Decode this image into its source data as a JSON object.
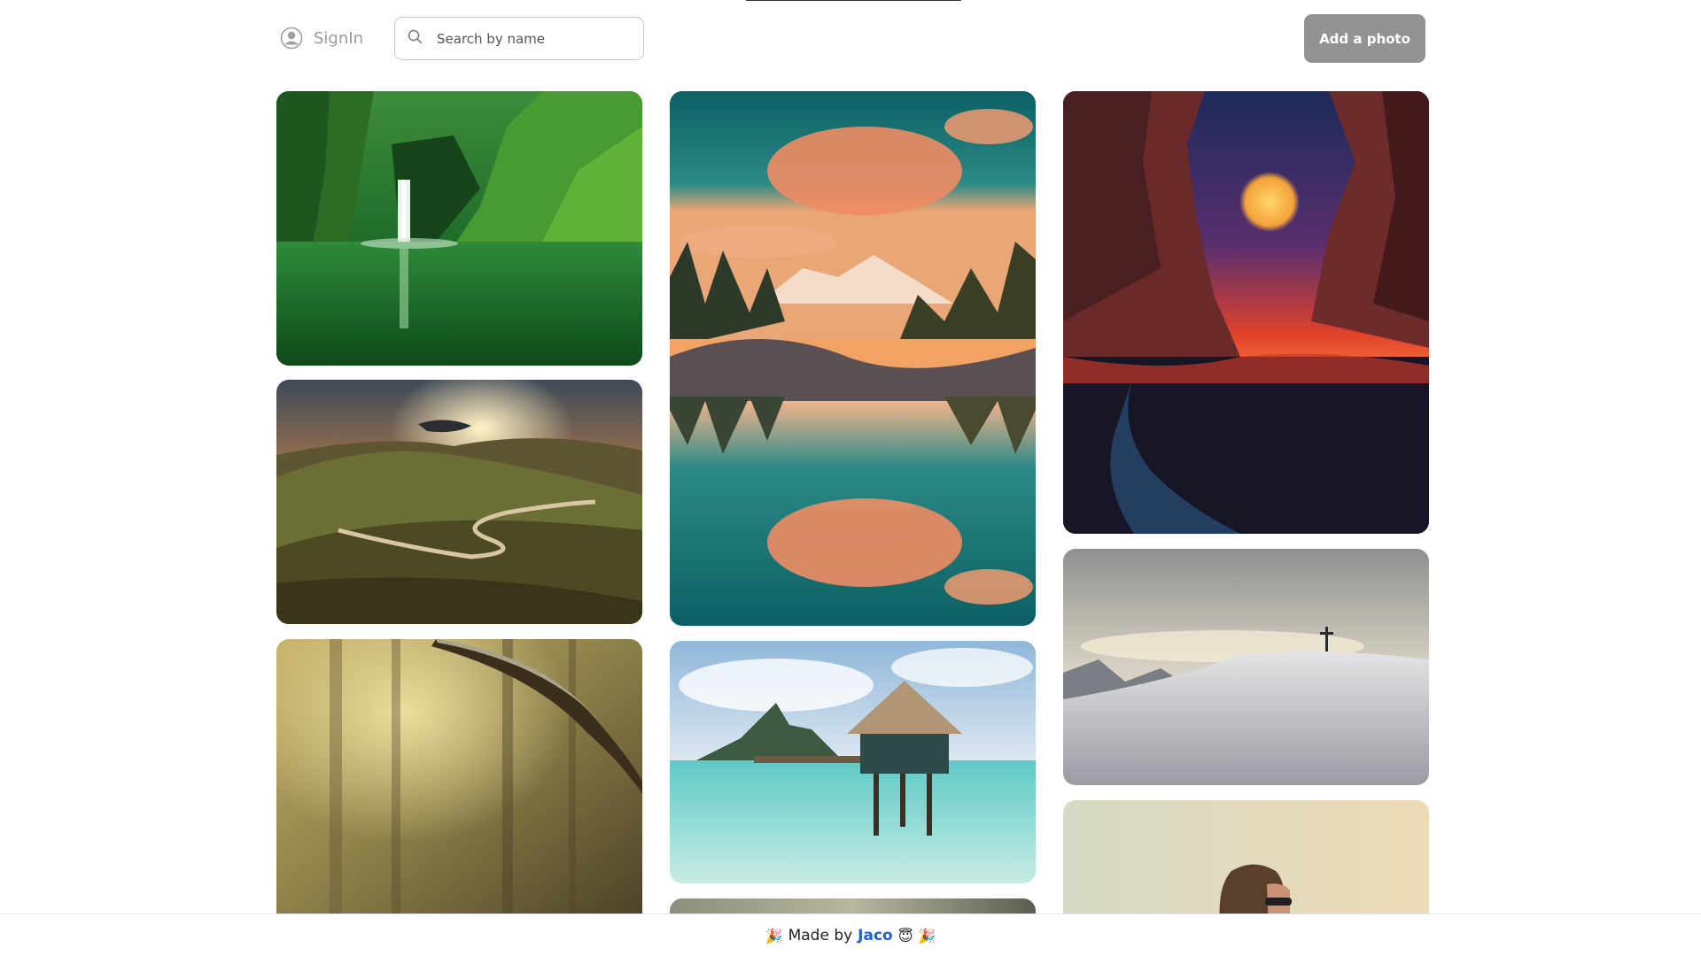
{
  "header": {
    "signin_label": "SignIn",
    "search_placeholder": "Search by name",
    "add_button_label": "Add a photo"
  },
  "gallery": {
    "photos": [
      {
        "subject": "green waterfall"
      },
      {
        "subject": "sunset valley"
      },
      {
        "subject": "forest light"
      },
      {
        "subject": "mountain lake reflection"
      },
      {
        "subject": "overwater bungalow"
      },
      {
        "subject": "cave moon beach"
      },
      {
        "subject": "snowy cross summit"
      },
      {
        "subject": "woman sunglasses"
      }
    ]
  },
  "footer": {
    "made_by": "Made by",
    "author": "Jaco",
    "emoji_left": "🎉",
    "emoji_face": "😇",
    "emoji_right": "🎉"
  }
}
